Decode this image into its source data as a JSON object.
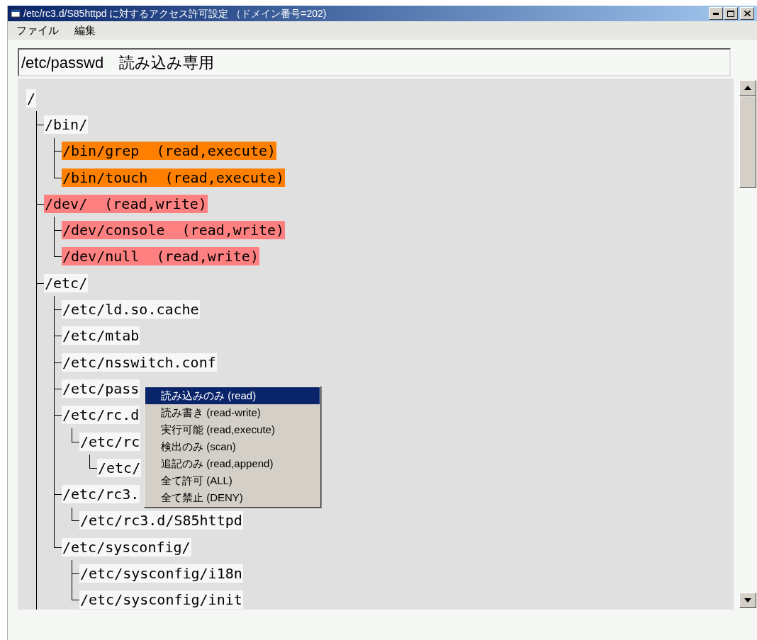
{
  "window": {
    "title": "/etc/rc3.d/S85httpd に対するアクセス許可設定 （ドメイン番号=202)"
  },
  "menu_bar": [
    "ファイル",
    "編集"
  ],
  "status_field": {
    "value": "/etc/passwd　読み込み専用"
  },
  "tree": {
    "label": "/",
    "more_below": true,
    "children": [
      {
        "label": "/bin/",
        "children": [
          {
            "label": "/bin/grep  (read,execute)",
            "color": "#ff8000"
          },
          {
            "label": "/bin/touch  (read,execute)",
            "color": "#ff8000"
          }
        ]
      },
      {
        "label": "/dev/  (read,write)",
        "color": "#ff8080",
        "children": [
          {
            "label": "/dev/console  (read,write)",
            "color": "#ff8080"
          },
          {
            "label": "/dev/null  (read,write)",
            "color": "#ff8080"
          }
        ]
      },
      {
        "label": "/etc/",
        "children": [
          {
            "label": "/etc/ld.so.cache"
          },
          {
            "label": "/etc/mtab"
          },
          {
            "label": "/etc/nsswitch.conf"
          },
          {
            "label": "/etc/pass"
          },
          {
            "label": "/etc/rc.d",
            "children": [
              {
                "label": "/etc/rc",
                "children": [
                  {
                    "label": "/etc/"
                  }
                ]
              }
            ]
          },
          {
            "label": "/etc/rc3.",
            "children": [
              {
                "label": "/etc/rc3.d/S85httpd"
              }
            ]
          },
          {
            "label": "/etc/sysconfig/",
            "children": [
              {
                "label": "/etc/sysconfig/i18n"
              },
              {
                "label": "/etc/sysconfig/init"
              }
            ]
          }
        ]
      }
    ]
  },
  "context_menu": [
    {
      "label": "読み込みのみ (read)",
      "selected": true
    },
    {
      "label": "読み書き (read-write)",
      "selected": false
    },
    {
      "label": "実行可能 (read,execute)",
      "selected": false
    },
    {
      "label": "検出のみ (scan)",
      "selected": false
    },
    {
      "label": "追記のみ (read,append)",
      "selected": false
    },
    {
      "label": "全て許可 (ALL)",
      "selected": false
    },
    {
      "label": "全て禁止 (DENY)",
      "selected": false
    }
  ]
}
